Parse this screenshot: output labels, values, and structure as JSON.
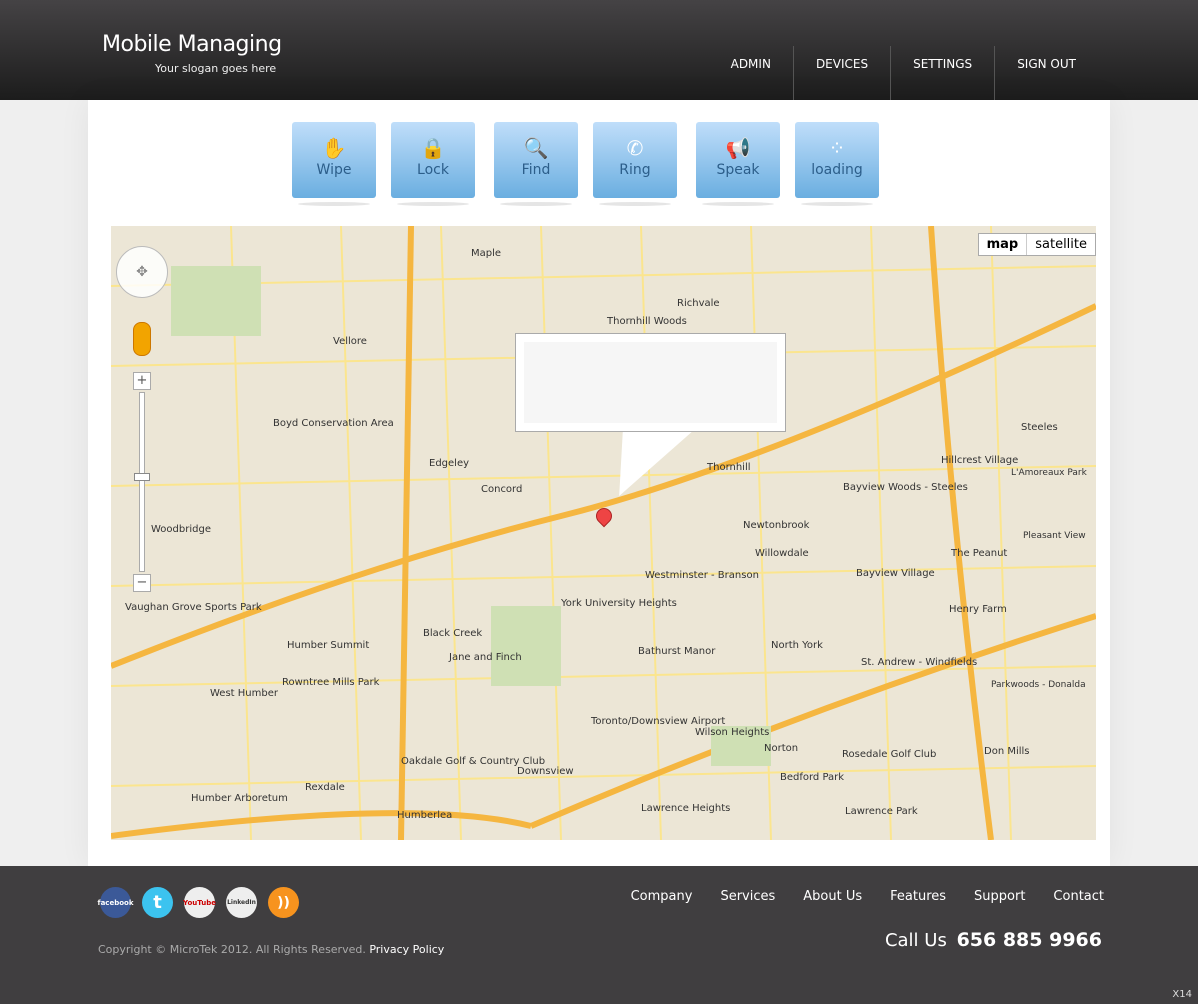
{
  "header": {
    "title": "Mobile Managing",
    "slogan": "Your slogan goes here",
    "nav": [
      "ADMIN",
      "DEVICES",
      "SETTINGS",
      "SIGN OUT"
    ]
  },
  "actions": [
    {
      "label": "Wipe",
      "icon": "hand-icon",
      "glyph": "✋"
    },
    {
      "label": "Lock",
      "icon": "lock-icon",
      "glyph": "🔒"
    },
    {
      "label": "Find",
      "icon": "search-icon",
      "glyph": "🔍"
    },
    {
      "label": "Ring",
      "icon": "phone-icon",
      "glyph": "✆"
    },
    {
      "label": "Speak",
      "icon": "megaphone-icon",
      "glyph": "📢"
    },
    {
      "label": "loading",
      "icon": "spinner-icon",
      "glyph": "⁘"
    }
  ],
  "map": {
    "types": [
      "map",
      "satellite"
    ],
    "zoom": {
      "plus": "+",
      "minus": "−"
    },
    "labels": [
      "Maple",
      "Richvale",
      "Vellore",
      "Thornhill Woods",
      "Edgeley",
      "Concord",
      "Thornhill",
      "Boyd Conservation Area",
      "Woodbridge",
      "Newtonbrook",
      "Willowdale",
      "Bayview Woods - Steeles",
      "Hillcrest Village",
      "Steeles",
      "Westminster - Branson",
      "York University Heights",
      "Black Creek",
      "Jane and Finch",
      "Humber Summit",
      "Bathurst Manor",
      "North York",
      "The Peanut",
      "Henry Farm",
      "Bayview Village",
      "St. Andrew - Windfields",
      "Parkwoods - Donalda",
      "Toronto/Downsview Airport",
      "Wilson Heights",
      "Downsview",
      "Oakdale Golf & Country Club",
      "Rexdale",
      "Humber Arboretum",
      "Humberlea",
      "Lawrence Heights",
      "Bedford Park",
      "Norton",
      "Rosedale Golf Club",
      "Lawrence Park",
      "Don Mills",
      "Vaughan Grove Sports Park",
      "West Humber",
      "Rowntree Mills Park",
      "Pleasant View",
      "L'Amoreaux Park"
    ]
  },
  "footer": {
    "social": [
      "facebook",
      "twitter",
      "YouTube",
      "LinkedIn",
      "rss"
    ],
    "copyright": "Copyright © MicroTek 2012. All Rights Reserved.",
    "privacy": "Privacy Policy",
    "nav": [
      "Company",
      "Services",
      "About Us",
      "Features",
      "Support",
      "Contact"
    ],
    "call_label": "Call Us",
    "phone": "656 885 9966",
    "corner": "X14"
  }
}
